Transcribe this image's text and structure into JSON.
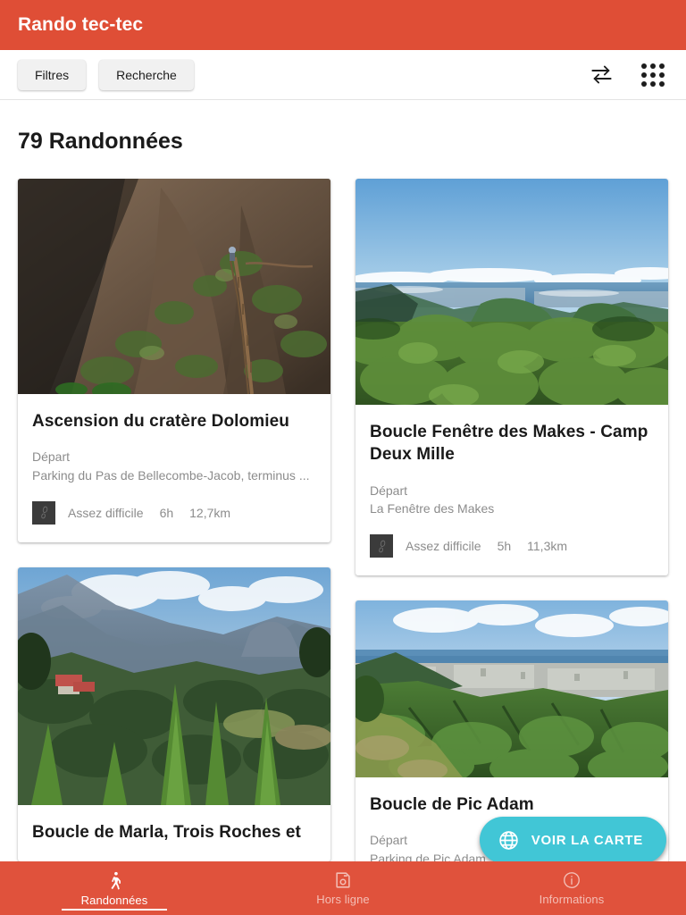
{
  "appbar": {
    "title": "Rando tec-tec"
  },
  "toolbar": {
    "filters_label": "Filtres",
    "search_label": "Recherche",
    "swap_icon": "swap-arrows-icon",
    "apps_icon": "apps-grid-icon"
  },
  "main": {
    "heading": "79 Randonnées",
    "start_label": "Départ",
    "cards": [
      {
        "title": "Ascension du cratère Dolomieu",
        "start_label": "Départ",
        "start": "Parking du Pas de Bellecombe-Jacob, terminus ...",
        "difficulty": "Assez difficile",
        "duration": "6h",
        "distance": "12,7km",
        "photo": "volcanic-crater-trail"
      },
      {
        "title": "Boucle Fenêtre des Makes - Camp Deux Mille",
        "start_label": "Départ",
        "start": "La Fenêtre des Makes",
        "difficulty": "Assez difficile",
        "duration": "5h",
        "distance": "11,3km",
        "photo": "coastal-panorama-green"
      },
      {
        "title": "Boucle de Marla, Trois Roches et",
        "start_label": "Départ",
        "start": "",
        "difficulty": "",
        "duration": "",
        "distance": "",
        "photo": "mountain-valley-agave"
      },
      {
        "title": "Boucle de Pic Adam",
        "start_label": "Départ",
        "start": "Parking de Pic Adam, Saint-Denis",
        "difficulty": "",
        "duration": "",
        "distance": "",
        "photo": "city-coast-ravine"
      }
    ]
  },
  "fab": {
    "label": "VOIR LA CARTE",
    "icon": "globe-icon"
  },
  "bottomnav": {
    "items": [
      {
        "label": "Randonnées",
        "icon": "walking-person-icon",
        "active": true
      },
      {
        "label": "Hors ligne",
        "icon": "save-floppy-icon",
        "active": false
      },
      {
        "label": "Informations",
        "icon": "info-circle-icon",
        "active": false
      }
    ]
  },
  "colors": {
    "primary": "#df4e36",
    "accent": "#41c6d6",
    "chip": "#f1f1f1",
    "text": "#1a1a1a",
    "muted": "#8c8c8c"
  }
}
